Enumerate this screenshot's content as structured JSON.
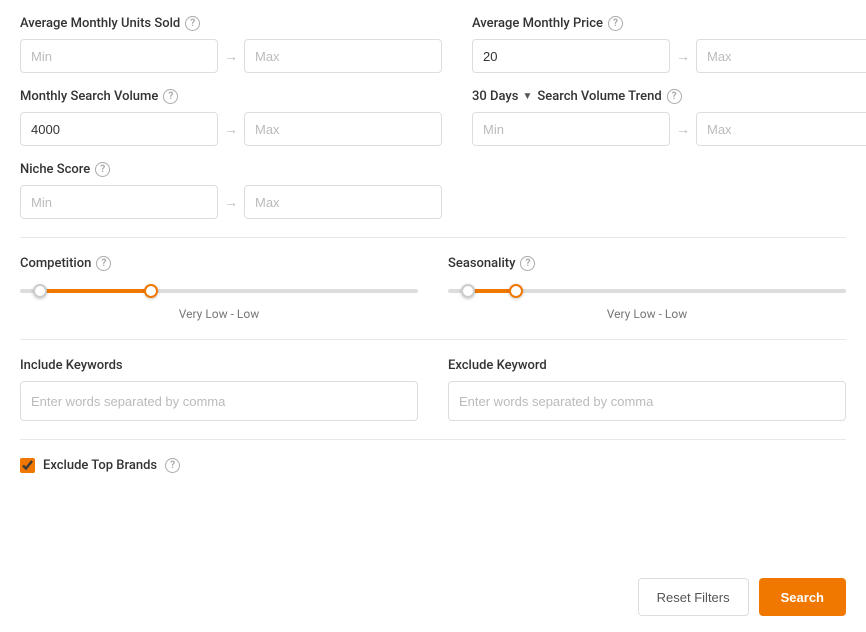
{
  "avgMonthlyUnitsSold": {
    "label": "Average Monthly Units Sold",
    "minPlaceholder": "Min",
    "maxPlaceholder": "Max",
    "minValue": "",
    "maxValue": ""
  },
  "avgMonthlyPrice": {
    "label": "Average Monthly Price",
    "minPlaceholder": "20",
    "maxPlaceholder": "Max",
    "minValue": "20",
    "maxValue": ""
  },
  "monthlySearchVolume": {
    "label": "Monthly Search Volume",
    "minPlaceholder": "4000",
    "maxPlaceholder": "Max",
    "minValue": "4000",
    "maxValue": ""
  },
  "searchVolumeTrend": {
    "dropdownLabel": "30 Days",
    "label": "Search Volume Trend",
    "minPlaceholder": "Min",
    "maxPlaceholder": "Max",
    "minValue": "",
    "maxValue": ""
  },
  "nicheScore": {
    "label": "Niche Score",
    "minPlaceholder": "Min",
    "maxPlaceholder": "Max",
    "minValue": "",
    "maxValue": ""
  },
  "competition": {
    "label": "Competition",
    "valueLabel": "Very Low  -  Low",
    "thumbLeftPct": 5,
    "thumbRightPct": 33
  },
  "seasonality": {
    "label": "Seasonality",
    "valueLabel": "Very Low  -  Low",
    "thumbLeftPct": 5,
    "thumbRightPct": 17
  },
  "includeKeywords": {
    "label": "Include Keywords",
    "placeholder": "Enter words separated by comma",
    "value": ""
  },
  "excludeKeyword": {
    "label": "Exclude Keyword",
    "placeholder": "Enter words separated by comma",
    "value": ""
  },
  "excludeTopBrands": {
    "label": "Exclude Top Brands",
    "checked": true
  },
  "buttons": {
    "reset": "Reset Filters",
    "search": "Search"
  }
}
